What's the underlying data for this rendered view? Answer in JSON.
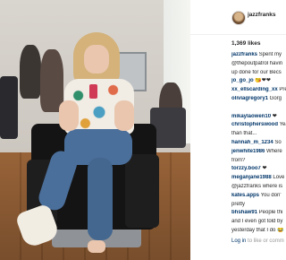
{
  "post": {
    "username": "jazzfranks",
    "likes": "1,369 likes"
  },
  "comments": [
    {
      "prefix": "",
      "user": "jazzfranks",
      "text": " Spent my"
    },
    {
      "prefix": "",
      "user": "",
      "text": "@thepoutpatrol havin"
    },
    {
      "prefix": "",
      "user": "",
      "text": "up done for our Becs"
    },
    {
      "prefix": "",
      "user": "jo_go_jo",
      "text": " 😘❤❤"
    },
    {
      "prefix": "",
      "user": "xx_ellscarding_xx",
      "text": " Pre"
    },
    {
      "prefix": "",
      "user": "oliviagregory1",
      "text": " Gorg"
    },
    {
      "prefix": "",
      "user": "",
      "text": ""
    },
    {
      "prefix": "",
      "user": "mikaylaowen10",
      "text": " ❤"
    },
    {
      "prefix": "",
      "user": "christopherswood",
      "text": " Yea"
    },
    {
      "prefix": "",
      "user": "",
      "text": "than that..."
    },
    {
      "prefix": "",
      "user": "hannah_m_1234",
      "text": " So"
    },
    {
      "prefix": "",
      "user": "jenwhite1986",
      "text": " Where"
    },
    {
      "prefix": "",
      "user": "",
      "text": "from?"
    },
    {
      "prefix": "",
      "user": "torzzy.boo7",
      "text": " ❤"
    },
    {
      "prefix": "",
      "user": "meganjane1988",
      "text": " Love"
    },
    {
      "prefix": "",
      "user": "",
      "text": "@jazzfranks where is"
    },
    {
      "prefix": "",
      "user": "kates.apps",
      "text": " You don'"
    },
    {
      "prefix": "",
      "user": "",
      "text": "pretty"
    },
    {
      "prefix": "",
      "user": "bhshaw91",
      "text": " People thi"
    },
    {
      "prefix": "",
      "user": "",
      "text": "and I even got told by"
    },
    {
      "prefix": "",
      "user": "",
      "text": "yesterday that I do 😂"
    }
  ],
  "login": {
    "link": "Log in",
    "rest": " to like or comm"
  }
}
